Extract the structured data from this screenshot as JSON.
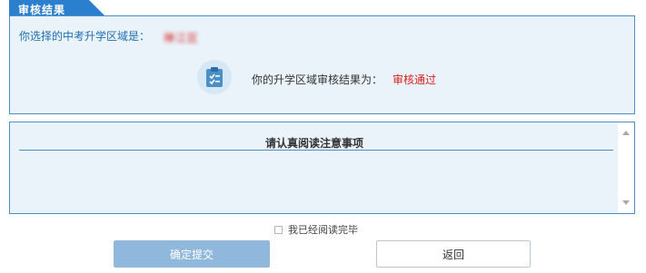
{
  "tab": {
    "label": "审核结果"
  },
  "result": {
    "region_label": "你选择的中考升学区域是：",
    "region_value": "禅江区",
    "status_label": "你的升学区域审核结果为：",
    "status_value": "审核通过",
    "status_icon": "clipboard-check-icon"
  },
  "notice": {
    "title": "请认真阅读注意事项",
    "body": ""
  },
  "confirm": {
    "checkbox_label": "我已经阅读完毕",
    "checked": false
  },
  "buttons": {
    "submit_label": "确定提交",
    "back_label": "返回"
  },
  "colors": {
    "accent": "#2a7fcf",
    "panel_bg": "#eaf3fa",
    "panel_border": "#4a90c6",
    "status_red": "#d81e1e",
    "submit_bg": "#8fb8dc"
  }
}
